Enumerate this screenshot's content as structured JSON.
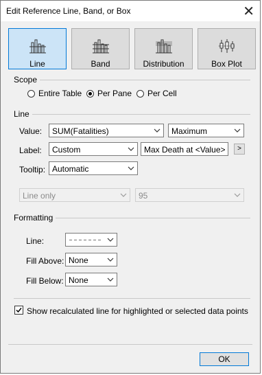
{
  "dialog": {
    "title": "Edit Reference Line, Band, or Box",
    "close_label": "✕"
  },
  "types": [
    {
      "label": "Line",
      "selected": true
    },
    {
      "label": "Band",
      "selected": false
    },
    {
      "label": "Distribution",
      "selected": false
    },
    {
      "label": "Box Plot",
      "selected": false
    }
  ],
  "scope": {
    "heading": "Scope",
    "options": [
      {
        "label": "Entire Table",
        "selected": false
      },
      {
        "label": "Per Pane",
        "selected": true
      },
      {
        "label": "Per Cell",
        "selected": false
      }
    ]
  },
  "line": {
    "heading": "Line",
    "value_label": "Value:",
    "value_field": "SUM(Fatalities)",
    "value_aggregation": "Maximum",
    "label_label": "Label:",
    "label_mode": "Custom",
    "label_text": "Max Death at <Value>",
    "label_insert_button": ">",
    "tooltip_label": "Tooltip:",
    "tooltip_mode": "Automatic",
    "interval_mode": "Line only",
    "confidence": "95"
  },
  "formatting": {
    "heading": "Formatting",
    "line_label": "Line:",
    "line_style": "dashed",
    "fill_above_label": "Fill Above:",
    "fill_above_value": "None",
    "fill_below_label": "Fill Below:",
    "fill_below_value": "None"
  },
  "recalc": {
    "label": "Show recalculated line for highlighted or selected data points",
    "checked": true
  },
  "footer": {
    "ok_label": "OK"
  },
  "colors": {
    "accent": "#0078d7",
    "selected_bg": "#cce4f7",
    "dialog_bg": "#f0f0f0"
  }
}
